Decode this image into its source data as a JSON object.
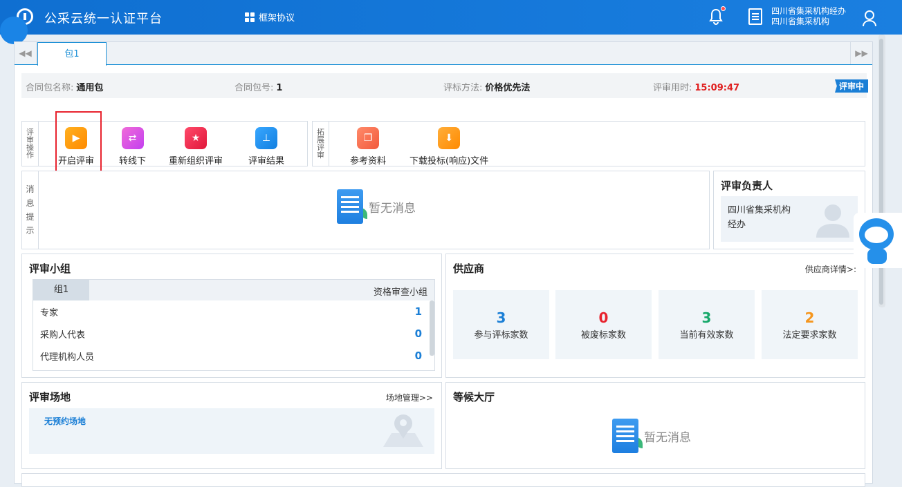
{
  "header": {
    "title": "公采云统一认证平台",
    "nav_framework": "框架协议",
    "user_line1": "四川省集采机构经办",
    "user_line2": "四川省集采机构"
  },
  "tabs": [
    {
      "label": "包1",
      "active": true
    }
  ],
  "contract": {
    "name_label": "合同包名称:",
    "name_value": "通用包",
    "no_label": "合同包号:",
    "no_value": "1",
    "method_label": "评标方法:",
    "method_value": "价格优先法",
    "time_label": "评审用时:",
    "time_value": "15:09:47",
    "status": "评审中"
  },
  "review_ops": {
    "label": "评审操作",
    "items": [
      {
        "label": "开启评审",
        "icon": "play-circle-icon",
        "color": "#ff8a00"
      },
      {
        "label": "转线下",
        "icon": "switch-icon",
        "color": "#c33ff0"
      },
      {
        "label": "重新组织评审",
        "icon": "star-icon",
        "color": "#e0173a"
      },
      {
        "label": "评审结果",
        "icon": "stamp-icon",
        "color": "#127fe0"
      }
    ]
  },
  "extend_ops": {
    "label": "拓展评审",
    "items": [
      {
        "label": "参考资料",
        "icon": "copy-icon",
        "color": "#f25a3c"
      },
      {
        "label": "下载投标(响应)文件",
        "icon": "download-icon",
        "color": "#ff8a00"
      }
    ]
  },
  "messages": {
    "label": "消息提示",
    "empty_text": "暂无消息"
  },
  "reviewer": {
    "title": "评审负责人",
    "name_line1": "四川省集采机构",
    "name_line2": "经办"
  },
  "panel_group": {
    "title": "评审小组",
    "group_tab": "组1",
    "group_type": "资格审查小组",
    "rows": [
      {
        "label": "专家",
        "value": "1"
      },
      {
        "label": "采购人代表",
        "value": "0"
      },
      {
        "label": "代理机构人员",
        "value": "0"
      }
    ]
  },
  "supplier": {
    "title": "供应商",
    "link": "供应商详情>:",
    "stats": [
      {
        "value": "3",
        "label": "参与评标家数",
        "color": "#1b7fd6"
      },
      {
        "value": "0",
        "label": "被废标家数",
        "color": "#e8232e"
      },
      {
        "value": "3",
        "label": "当前有效家数",
        "color": "#17a86a"
      },
      {
        "value": "2",
        "label": "法定要求家数",
        "color": "#f5961e"
      }
    ]
  },
  "venue": {
    "title": "评审场地",
    "link": "场地管理>>",
    "empty_text": "无预约场地"
  },
  "waiting": {
    "title": "等候大厅",
    "empty_text": "暂无消息"
  }
}
